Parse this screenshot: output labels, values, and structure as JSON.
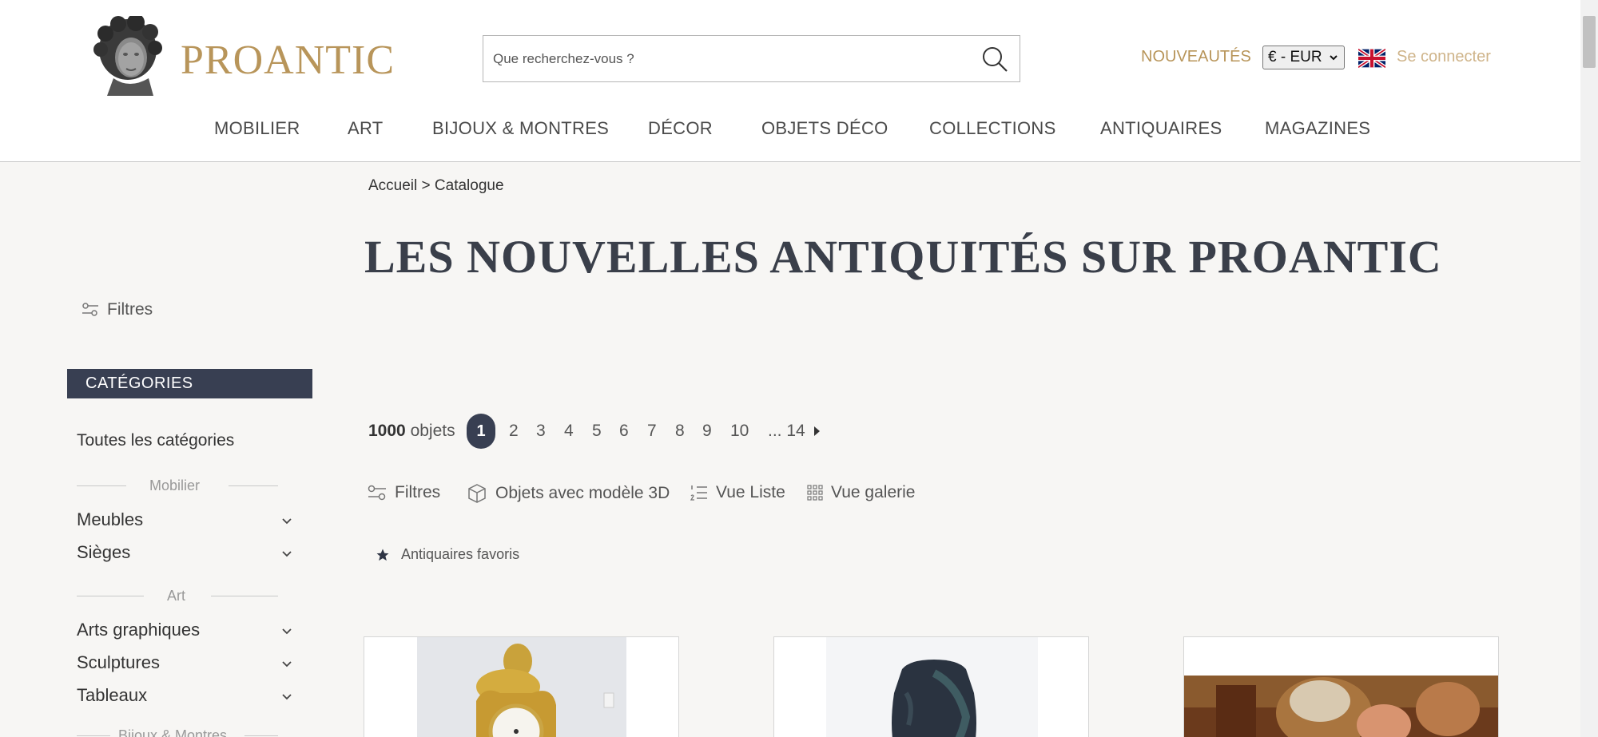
{
  "brand": {
    "name": "PROANTIC"
  },
  "search": {
    "placeholder": "Que recherchez-vous ?"
  },
  "header": {
    "new_label": "NOUVEAUTÉS",
    "currency": "€ - EUR",
    "login_label": "Se connecter"
  },
  "nav": [
    "MOBILIER",
    "ART",
    "BIJOUX & MONTRES",
    "DÉCOR",
    "OBJETS DÉCO",
    "COLLECTIONS",
    "ANTIQUAIRES",
    "MAGAZINES"
  ],
  "breadcrumb": {
    "home": "Accueil",
    "separator": ">",
    "current": "Catalogue"
  },
  "page_title": "LES NOUVELLES ANTIQUITÉS SUR PROANTIC",
  "sidebar": {
    "filters_label": "Filtres",
    "categories_header": "CATÉGORIES",
    "all_categories": "Toutes les catégories",
    "sections": [
      {
        "title": "Mobilier",
        "items": [
          "Meubles",
          "Sièges"
        ]
      },
      {
        "title": "Art",
        "items": [
          "Arts graphiques",
          "Sculptures",
          "Tableaux"
        ]
      },
      {
        "title": "Bijoux & Montres",
        "items": []
      }
    ]
  },
  "results": {
    "count": "1000",
    "count_unit": "objets",
    "pages": [
      "1",
      "2",
      "3",
      "4",
      "5",
      "6",
      "7",
      "8",
      "9",
      "10"
    ],
    "last_page": "... 14",
    "current_page": "1"
  },
  "toolbar": {
    "filters": "Filtres",
    "models_3d": "Objets avec modèle 3D",
    "list_view": "Vue Liste",
    "gallery_view": "Vue galerie",
    "favorites": "Antiquaires favoris"
  },
  "colors": {
    "brand_gold": "#b8955a",
    "dark_navy": "#383f52",
    "background": "#f7f6f4"
  }
}
